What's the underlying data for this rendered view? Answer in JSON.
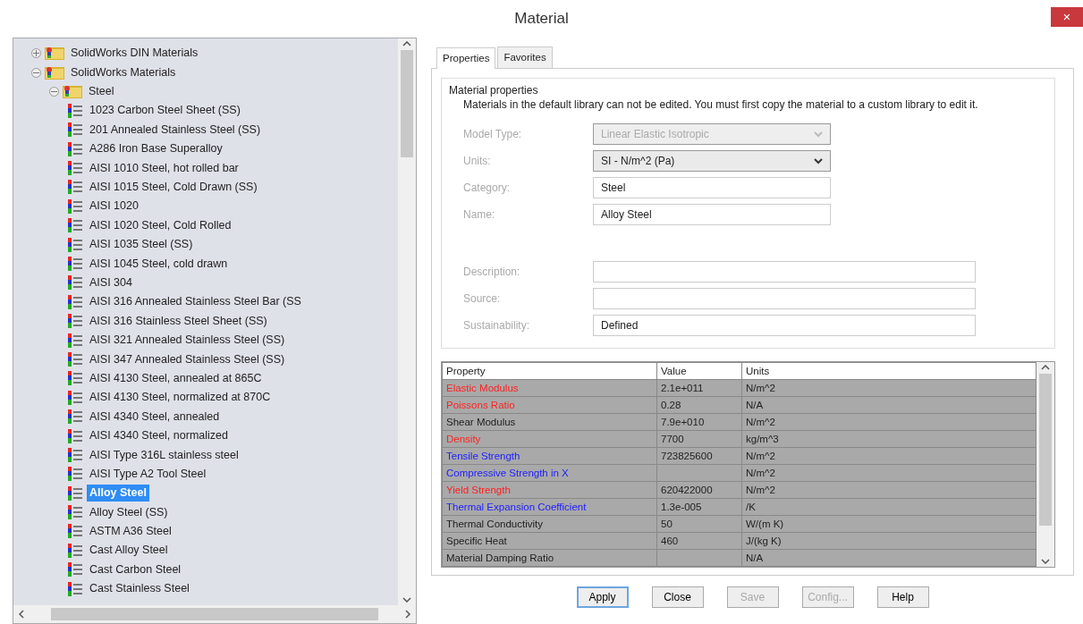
{
  "window": {
    "title": "Material",
    "close": "×"
  },
  "tree": [
    {
      "label": "SolidWorks DIN Materials",
      "kind": "library",
      "expanded": false,
      "selected": false
    },
    {
      "label": "SolidWorks Materials",
      "kind": "library",
      "expanded": true,
      "selected": false,
      "children": [
        {
          "label": "Steel",
          "kind": "category",
          "expanded": true,
          "selected": false,
          "children": [
            {
              "label": "1023 Carbon Steel Sheet (SS)",
              "kind": "material",
              "selected": false
            },
            {
              "label": "201 Annealed Stainless Steel (SS)",
              "kind": "material",
              "selected": false
            },
            {
              "label": "A286 Iron Base Superalloy",
              "kind": "material",
              "selected": false
            },
            {
              "label": "AISI 1010 Steel, hot rolled bar",
              "kind": "material",
              "selected": false
            },
            {
              "label": "AISI 1015 Steel, Cold Drawn (SS)",
              "kind": "material",
              "selected": false
            },
            {
              "label": "AISI 1020",
              "kind": "material",
              "selected": false
            },
            {
              "label": "AISI 1020 Steel, Cold Rolled",
              "kind": "material",
              "selected": false
            },
            {
              "label": "AISI 1035 Steel (SS)",
              "kind": "material",
              "selected": false
            },
            {
              "label": "AISI 1045 Steel, cold drawn",
              "kind": "material",
              "selected": false
            },
            {
              "label": "AISI 304",
              "kind": "material",
              "selected": false
            },
            {
              "label": "AISI 316 Annealed Stainless Steel Bar (SS",
              "kind": "material",
              "selected": false
            },
            {
              "label": "AISI 316 Stainless Steel Sheet (SS)",
              "kind": "material",
              "selected": false
            },
            {
              "label": "AISI 321 Annealed Stainless Steel (SS)",
              "kind": "material",
              "selected": false
            },
            {
              "label": "AISI 347 Annealed Stainless Steel (SS)",
              "kind": "material",
              "selected": false
            },
            {
              "label": "AISI 4130 Steel, annealed at 865C",
              "kind": "material",
              "selected": false
            },
            {
              "label": "AISI 4130 Steel, normalized at 870C",
              "kind": "material",
              "selected": false
            },
            {
              "label": "AISI 4340 Steel, annealed",
              "kind": "material",
              "selected": false
            },
            {
              "label": "AISI 4340 Steel, normalized",
              "kind": "material",
              "selected": false
            },
            {
              "label": "AISI Type 316L stainless steel",
              "kind": "material",
              "selected": false
            },
            {
              "label": "AISI Type A2 Tool Steel",
              "kind": "material",
              "selected": false
            },
            {
              "label": "Alloy Steel",
              "kind": "material",
              "selected": true
            },
            {
              "label": "Alloy Steel (SS)",
              "kind": "material",
              "selected": false
            },
            {
              "label": "ASTM A36 Steel",
              "kind": "material",
              "selected": false
            },
            {
              "label": "Cast Alloy Steel",
              "kind": "material",
              "selected": false
            },
            {
              "label": "Cast Carbon Steel",
              "kind": "material",
              "selected": false
            },
            {
              "label": "Cast Stainless Steel",
              "kind": "material",
              "selected": false
            }
          ]
        }
      ]
    }
  ],
  "tabs": [
    {
      "label": "Properties",
      "selected": true
    },
    {
      "label": "Favorites",
      "selected": false
    }
  ],
  "group": {
    "title": "Material properties",
    "note": "Materials in the default library can not be edited. You must first copy the material to a custom library to edit it."
  },
  "fields": [
    {
      "label": "Model Type:",
      "kind": "select",
      "value": "Linear Elastic Isotropic",
      "disabled": true
    },
    {
      "label": "Units:",
      "kind": "select",
      "value": "SI - N/m^2 (Pa)",
      "disabled": false
    },
    {
      "label": "Category:",
      "kind": "text",
      "value": "Steel",
      "disabled": false
    },
    {
      "label": "Name:",
      "kind": "text",
      "value": "Alloy Steel",
      "disabled": false
    },
    {
      "label": "Description:",
      "kind": "long-text",
      "disabled": false
    },
    {
      "label": "Source:",
      "kind": "long-text",
      "disabled": false
    },
    {
      "label": "Sustainability:",
      "kind": "long-text",
      "value": "Defined",
      "disabled": false
    }
  ],
  "table": {
    "columns": [
      "Property",
      "Value",
      "Units"
    ],
    "rows": [
      {
        "property": "Elastic Modulus",
        "value": "2.1e+011",
        "units": "N/m^2",
        "color": "#ff2020"
      },
      {
        "property": "Poissons Ratio",
        "value": "0.28",
        "units": "N/A",
        "color": "#ff2020"
      },
      {
        "property": "Shear Modulus",
        "value": "7.9e+010",
        "units": "N/m^2",
        "color": "#202020"
      },
      {
        "property": "Density",
        "value": "7700",
        "units": "kg/m^3",
        "color": "#ff2020"
      },
      {
        "property": "Tensile Strength",
        "value": "723825600",
        "units": "N/m^2",
        "color": "#2020ff"
      },
      {
        "property": "Compressive Strength in X",
        "units": "N/m^2",
        "color": "#2020ff"
      },
      {
        "property": "Yield Strength",
        "value": "620422000",
        "units": "N/m^2",
        "color": "#ff2020"
      },
      {
        "property": "Thermal Expansion Coefficient",
        "value": "1.3e-005",
        "units": "/K",
        "color": "#2020ff"
      },
      {
        "property": "Thermal Conductivity",
        "value": "50",
        "units": "W/(m K)",
        "color": "#202020"
      },
      {
        "property": "Specific Heat",
        "value": "460",
        "units": "J/(kg K)",
        "color": "#202020"
      },
      {
        "property": "Material Damping Ratio",
        "units": "N/A",
        "color": "#202020"
      }
    ]
  },
  "buttons": [
    {
      "label": "Apply",
      "default": true,
      "disabled": false
    },
    {
      "label": "Close",
      "default": false,
      "disabled": false
    },
    {
      "label": "Save",
      "default": false,
      "disabled": true
    },
    {
      "label": "Config...",
      "default": false,
      "disabled": true
    },
    {
      "label": "Help",
      "default": false,
      "disabled": false
    }
  ]
}
